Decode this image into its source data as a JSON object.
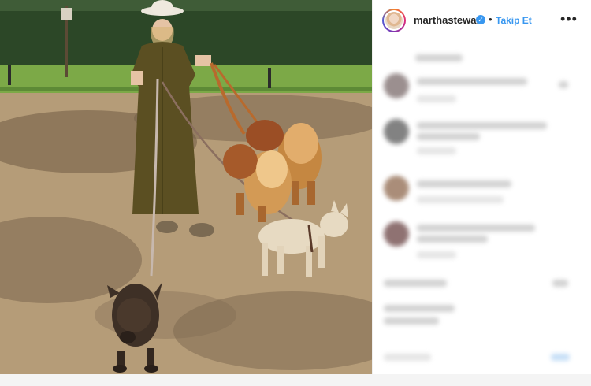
{
  "header": {
    "username": "marthastewart",
    "verified_glyph": "✓",
    "separator": "•",
    "follow_label": "Takip Et",
    "more_label": "•••"
  },
  "icons": {
    "verified": "verified-badge-icon",
    "more": "more-options-icon"
  },
  "colors": {
    "accent": "#3897f0",
    "text": "#262626",
    "divider": "#efefef"
  }
}
